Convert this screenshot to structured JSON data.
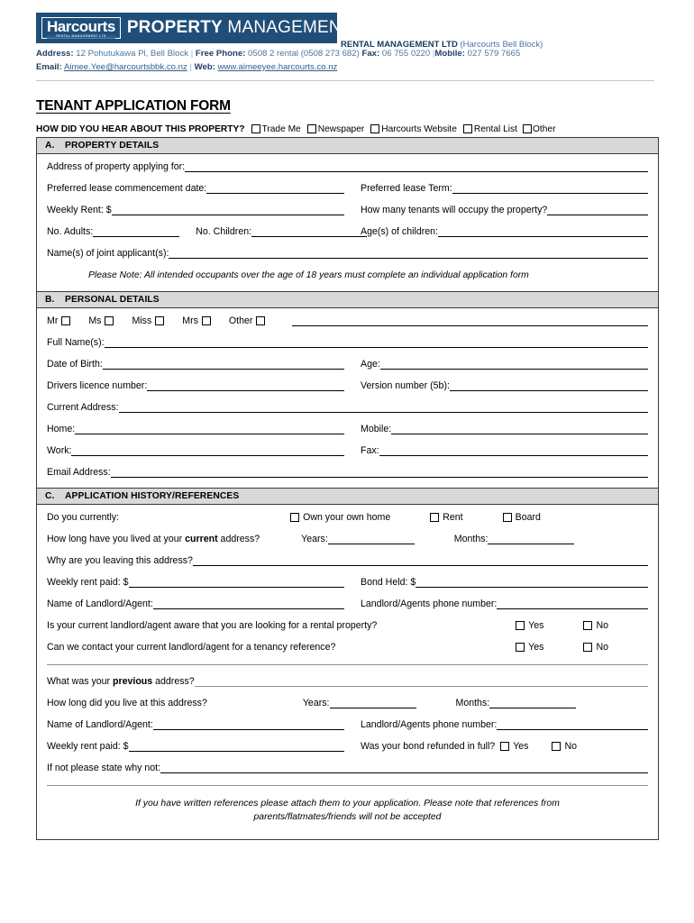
{
  "letterhead": {
    "logo_word": "Harcourts",
    "logo_sub": "RENTAL MANAGEMENT LTD",
    "banner_bold": "PROPERTY",
    "banner_light": " MANAGEMENT",
    "company_bold": "RENTAL MANAGEMENT LTD",
    "company_muted": " (Harcourts Bell Block)",
    "address_label": "Address:",
    "address_value": "12 Pohutukawa Pl, Bell Block",
    "phone_label": "Free Phone:",
    "phone_value": "0508 2 rental (0508 273 682)",
    "fax_label": "Fax:",
    "fax_value": "06 755 0220",
    "mobile_label": "Mobile:",
    "mobile_value": "027 579 7665",
    "email_label": "Email:",
    "email_value": "Aimee.Yee@harcourtsbbk.co.nz",
    "web_label": "Web:",
    "web_value": "www.aimeeyee.harcourts.co.nz",
    "pipe": "|"
  },
  "title": "TENANT APPLICATION FORM",
  "hear_about": {
    "question": "HOW DID YOU HEAR ABOUT THIS PROPERTY?",
    "options": [
      "Trade Me",
      "Newspaper",
      "Harcourts Website",
      "Rental List",
      "Other"
    ]
  },
  "section_a": {
    "letter": "A.",
    "title": "PROPERTY DETAILS",
    "address_label": "Address of property applying for:",
    "commencement_label": "Preferred lease commencement date:",
    "lease_term_label": "Preferred lease Term:",
    "weekly_rent_label": "Weekly Rent: $",
    "tenants_label": "How many tenants will occupy the property?",
    "adults_label": "No. Adults:",
    "children_label": "No. Children:",
    "ages_label": "Age(s) of children:",
    "joint_label": "Name(s) of joint applicant(s):",
    "note": "Please Note:  All intended occupants over the age of 18 years must complete an individual application form"
  },
  "section_b": {
    "letter": "B.",
    "title": "PERSONAL DETAILS",
    "titles": [
      "Mr",
      "Ms",
      "Miss",
      "Mrs",
      "Other"
    ],
    "full_name_label": "Full Name(s):",
    "dob_label": "Date of Birth:",
    "age_label": "Age:",
    "licence_label": "Drivers licence number:",
    "version_label": "Version number (5b):",
    "current_address_label": "Current Address:",
    "home_label": "Home:",
    "mobile_label": "Mobile:",
    "work_label": "Work:",
    "fax_label": "Fax:",
    "email_label": "Email Address:"
  },
  "section_c": {
    "letter": "C.",
    "title": "APPLICATION HISTORY/REFERENCES",
    "do_you_currently_label": "Do you currently:",
    "tenure_options": [
      "Own your own home",
      "Rent",
      "Board"
    ],
    "how_long_current_label_1": "How long have you lived at your ",
    "how_long_current_label_bold": "current",
    "how_long_current_label_2": " address?",
    "years_label": "Years:",
    "months_label": "Months:",
    "why_leaving_label": "Why are you leaving this address?",
    "weekly_rent_paid_label": "Weekly rent paid: $",
    "bond_held_label": "Bond Held: $",
    "landlord_name_label": "Name of Landlord/Agent:",
    "landlord_phone_label": "Landlord/Agents phone number:",
    "aware_question": "Is your current landlord/agent aware that you are looking for a rental property?",
    "contact_question": "Can we contact your current landlord/agent for a tenancy reference?",
    "yes": "Yes",
    "no": "No",
    "previous_label_1": "What was your ",
    "previous_label_bold": "previous",
    "previous_label_2": " address?",
    "how_long_previous_label": "How long did you live at this address?",
    "bond_refunded_label": "Was your bond refunded in full?",
    "if_not_label": "If not please state why not:",
    "footer_note_line1": "If you have written references please attach them to your application.  Please note that references from",
    "footer_note_line2": "parents/flatmates/friends will not be accepted"
  },
  "colors": {
    "brand_navy": "#1f4e79",
    "section_gray": "#d9d9d9",
    "link_blue": "#2d5f8f"
  }
}
